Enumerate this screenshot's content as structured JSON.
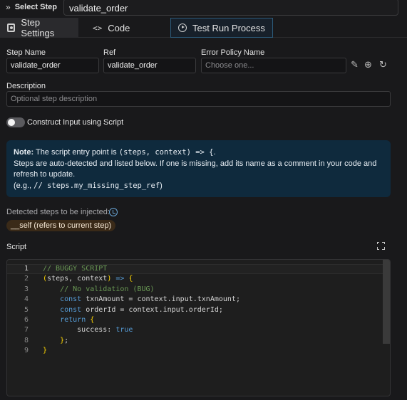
{
  "topbar": {
    "select_step_label": "Select Step",
    "chevrons": "»",
    "selected_step": "validate_order"
  },
  "tabs": [
    {
      "label": "Step Settings",
      "icon": "settings-icon"
    },
    {
      "label": "Code",
      "icon": "code-icon"
    },
    {
      "label": "Test Run Process",
      "icon": "play-circle-icon"
    }
  ],
  "form": {
    "step_name_label": "Step Name",
    "step_name_value": "validate_order",
    "ref_label": "Ref",
    "ref_value": "validate_order",
    "error_policy_label": "Error Policy Name",
    "error_policy_placeholder": "Choose one...",
    "description_label": "Description",
    "description_placeholder": "Optional step description",
    "construct_input_label": "Construct Input using Script"
  },
  "note": {
    "title": "Note:",
    "line1_prefix": "The script entry point is",
    "line1_code": "(steps, context) => {",
    "line1_suffix": ".",
    "line2": "Steps are auto-detected and listed below. If one is missing, add its name as a comment in your code and refresh to update.",
    "line3_prefix": "(e.g.,",
    "line3_code": "// steps.my_missing_step_ref",
    "line3_suffix": ")"
  },
  "detected": {
    "label": "Detected steps to be injected:",
    "badge": "__self (refers to current step)"
  },
  "script": {
    "label": "Script",
    "line_numbers": [
      "1",
      "2",
      "3",
      "4",
      "5",
      "6",
      "7",
      "8",
      "9"
    ],
    "lines": [
      "// BUGGY SCRIPT",
      "(steps, context) => {",
      "    // No validation (BUG)",
      "    const txnAmount = context.input.txnAmount;",
      "    const orderId = context.input.orderId;",
      "    return {",
      "        success: true",
      "    };",
      "}"
    ]
  },
  "colors": {
    "accent_blue": "#2c5a7a",
    "note_bg": "#0f2a3d",
    "badge_bg": "#3a2a18"
  }
}
